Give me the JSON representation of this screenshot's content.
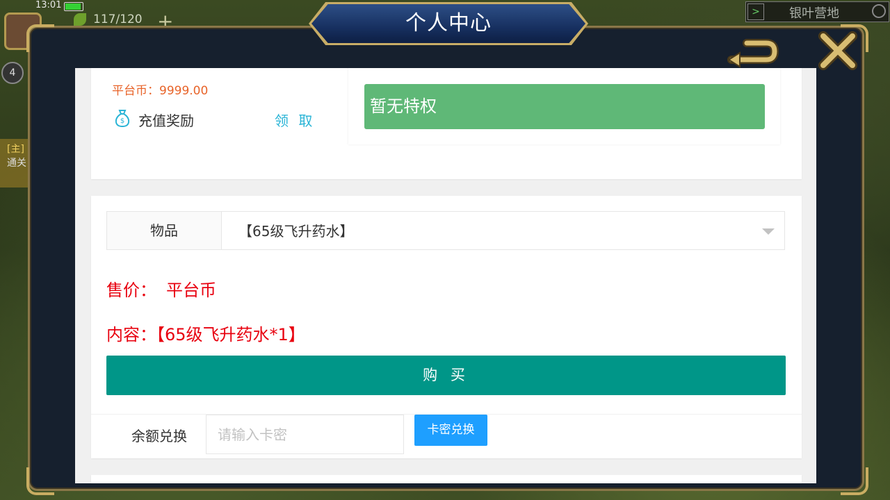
{
  "status_bar": {
    "time": "13:01",
    "stamina": "117/120",
    "level": "4"
  },
  "hud": {
    "plus_label": "+",
    "quest_tag": "[主]",
    "quest_text": "通关",
    "location": "银叶营地"
  },
  "dialog": {
    "title": "个人中心",
    "account": {
      "coins_label": "平台币：9999.00",
      "reward_label": "充值奖励",
      "claim_label": "领 取"
    },
    "privilege": {
      "label": "暂无特权"
    },
    "shop": {
      "item_label": "物品",
      "item_value": "【65级飞升药水】",
      "price_label": "售价：",
      "price_value": "平台币",
      "contents_label": "内容：",
      "contents_value": "【65级飞升药水*1】",
      "buy_label": "购 买"
    },
    "redeem": {
      "label": "余额兑换",
      "placeholder": "请输入卡密",
      "button_label": "卡密兑换"
    }
  },
  "colors": {
    "coins": "#e8642a",
    "claim": "#29b4d6",
    "privilege_bg": "#5fb877",
    "price_text": "#e8000f",
    "buy_bg": "#009688",
    "redeem_btn_bg": "#1e9fff"
  }
}
